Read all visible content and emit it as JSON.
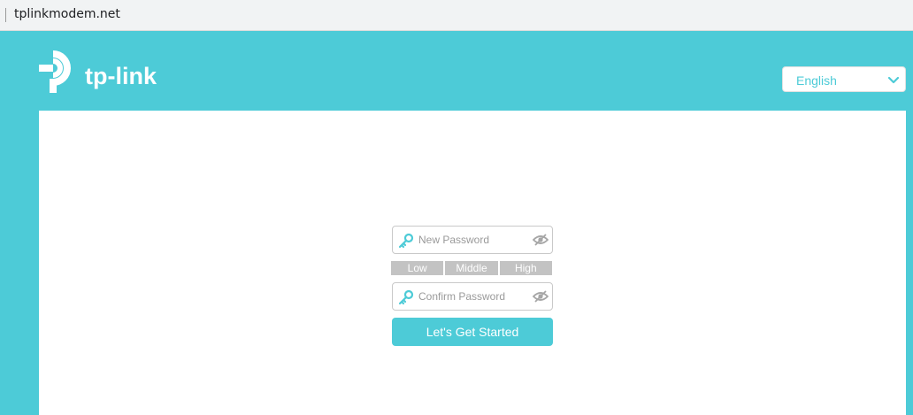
{
  "browser": {
    "url": "tplinkmodem.net"
  },
  "header": {
    "brand": "tp-link",
    "language": {
      "selected": "English"
    }
  },
  "form": {
    "new_password": {
      "placeholder": "New Password",
      "value": ""
    },
    "strength": [
      "Low",
      "Middle",
      "High"
    ],
    "confirm_password": {
      "placeholder": "Confirm Password",
      "value": ""
    },
    "submit_label": "Let's Get Started"
  },
  "colors": {
    "brand": "#4dcbd7",
    "strength_bar": "#c3c3c3",
    "border": "#c9c9c9"
  },
  "icons": [
    "tp-link-logo",
    "chevron-down-icon",
    "key-icon",
    "eye-off-icon"
  ]
}
